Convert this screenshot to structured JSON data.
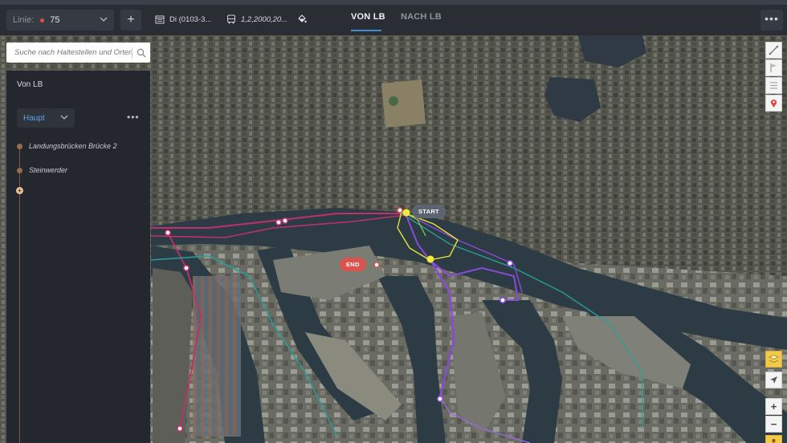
{
  "toolbar": {
    "line_label": "Linie:",
    "line_value": "75",
    "add_label": "+",
    "schedule_text": "Di (0103-3...",
    "vehicles_text": "1,2,2000,20...",
    "tabs": [
      {
        "label": "VON LB",
        "active": true
      },
      {
        "label": "NACH LB",
        "active": false
      }
    ],
    "more_label": "•••"
  },
  "search": {
    "placeholder": "Suche nach Haltestellen und Orten"
  },
  "panel": {
    "title": "Von LB",
    "route_variant": "Haupt",
    "kebab": "•••",
    "stops": [
      {
        "name": "Landungsbrücken Brücke 2"
      },
      {
        "name": "Steinwerder"
      }
    ],
    "add_stop_label": "+"
  },
  "map": {
    "start_label": "START",
    "end_label": "END",
    "zoom_in": "+",
    "zoom_out": "−"
  },
  "colors": {
    "accent": "#3e8ed0",
    "route_magenta": "#c0306a",
    "route_teal": "#2a9c98",
    "route_purple": "#8a4ad8",
    "route_yellow": "#e8e03a",
    "end_red": "#d9534f"
  }
}
